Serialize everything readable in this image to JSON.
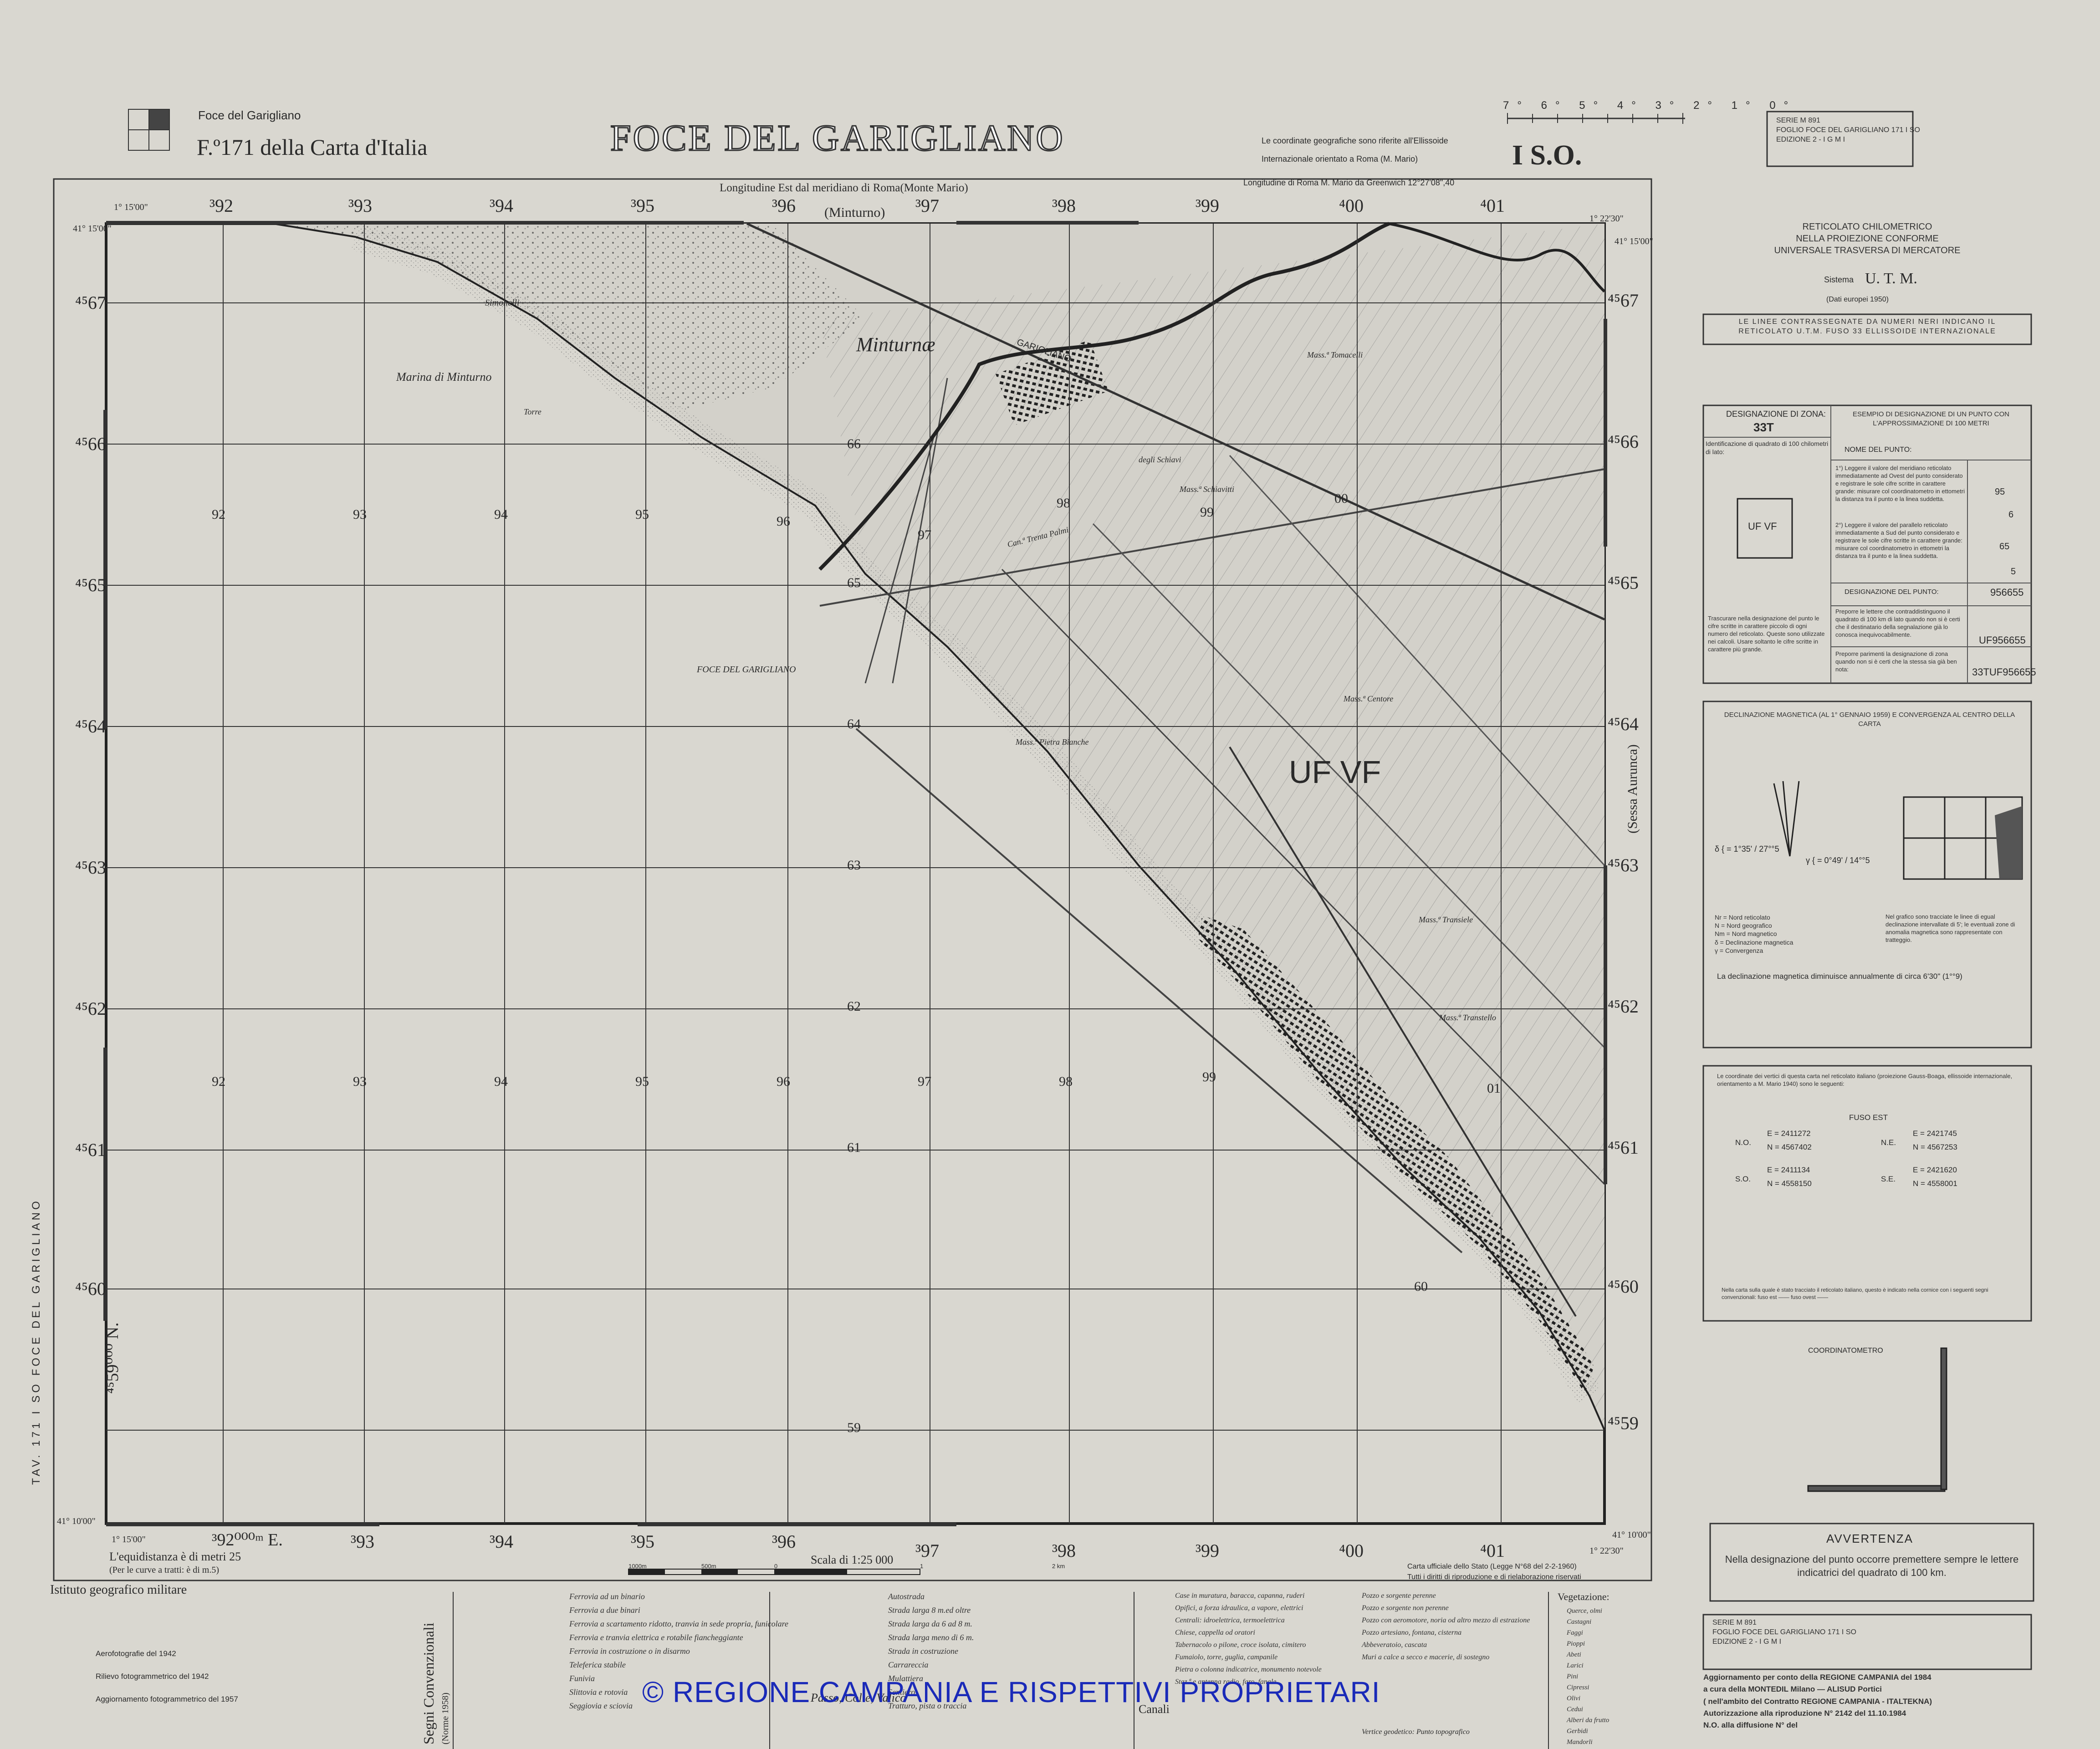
{
  "header": {
    "small_title": "Foce del Garigliano",
    "sheet": "F.º171 della Carta d'Italia",
    "main_title": "FOCE DEL GARIGLIANO",
    "quadrant": "I S.O.",
    "ellipsoid_note_1": "Le coordinate geografiche sono riferite all'Ellissoide",
    "ellipsoid_note_2": "Internazionale orientato a Roma (M. Mario)",
    "longitude_note": "Longitudine Est dal meridiano di Roma(Monte Mario)",
    "greenwich_note": "Longitudine di Roma M. Mario da Greenwich 12°27'08\",40",
    "scale_ticks": "7° 6° 5° 4° 3° 2° 1° 0°"
  },
  "map": {
    "corner_labels": {
      "top_left": "1° 15'00\"",
      "top_right": "1° 22'30\"",
      "bottom_left": "1° 15'00\"",
      "bottom_right": "1° 22'30\"",
      "lat_top_left": "41° 15'00\"",
      "lat_top_right": "41° 15'00\"",
      "lat_bottom_left": "41° 10'00\"",
      "lat_bottom_right": "41° 10'00\""
    },
    "top_eastings": [
      "³92",
      "³93",
      "³94",
      "³95",
      "³96",
      "³97",
      "³98",
      "³99",
      "⁴00",
      "⁴01"
    ],
    "bottom_eastings": [
      "³92⁰⁰⁰ᵐ E.",
      "³93",
      "³94",
      "³95",
      "³96",
      "³97",
      "³98",
      "³99",
      "⁴00",
      "⁴01"
    ],
    "left_northings": [
      "⁴⁵67",
      "⁴⁵66",
      "⁴⁵65",
      "⁴⁵64",
      "⁴⁵63",
      "⁴⁵62",
      "⁴⁵61",
      "⁴⁵60",
      "⁴⁵59⁰⁰⁰ N."
    ],
    "right_northings": [
      "⁴⁵67",
      "⁴⁵66",
      "⁴⁵65",
      "⁴⁵64",
      "⁴⁵63",
      "⁴⁵62",
      "⁴⁵61",
      "⁴⁵60",
      "⁴⁵59"
    ],
    "inner_easting_labels": [
      "92",
      "93",
      "94",
      "95",
      "96",
      "97",
      "98",
      "99"
    ],
    "inner_northing_labels": [
      "66",
      "65",
      "64",
      "63",
      "62",
      "61",
      "60",
      "59"
    ],
    "place_names": [
      "Marina di Minturno",
      "Minturnæ",
      "Simonelli",
      "GARIGLIANO",
      "FOCE DEL GARIGLIANO",
      "UF VF",
      "(Sessa Aurunca)",
      "(Minturno)",
      "Torre",
      "Mass.ª Tomacelli",
      "Mass.ª Centore",
      "Mass.ª Transiele",
      "Mass.ª Transtello",
      "degli Schiavi",
      "Mass.ª Schiavitti",
      "Can.ª Trenta Palmi",
      "Mass.ª Pietra Bianche"
    ],
    "map_ref_marks": [
      "00",
      "01"
    ],
    "zone_label": "UF VF"
  },
  "side_panel": {
    "series_box": {
      "line1": "SERIE  M 891",
      "line2": "FOGLIO  FOCE DEL GARIGLIANO 171 I SO",
      "line3": "EDIZIONE 2  -  I G M I"
    },
    "grid_title": [
      "RETICOLATO  CHILOMETRICO",
      "NELLA  PROIEZIONE  CONFORME",
      "UNIVERSALE  TRASVERSA  DI  MERCATORE"
    ],
    "system_label": "Sistema",
    "system": "U. T. M.",
    "datum": "(Dati europei 1950)",
    "lines_note": "LE LINEE CONTRASSEGNATE DA NUMERI NERI INDICANO IL RETICOLATO U.T.M. FUSO 33 ELLISSOIDE INTERNAZIONALE",
    "zone_designation_label": "DESIGNAZIONE DI ZONA:",
    "zone_value": "33T",
    "square_ident": "Identificazione di quadrato di 100 chilometri di lato:",
    "square_value": "UF VF",
    "point_example_title": "ESEMPIO DI DESIGNAZIONE DI UN PUNTO CON L'APPROSSIMAZIONE DI 100 METRI",
    "point_name_label": "NOME DEL PUNTO:",
    "step1": "1°) Leggere il valore del meridiano reticolato immediatamente ad Ovest del punto considerato e registrare le sole cifre scritte in carattere grande: misurare col coordinatometro in ettometri la distanza tra il punto e la linea suddetta.",
    "step2": "2°) Leggere il valore del parallelo reticolato immediatamente a Sud del punto considerato e registrare le sole cifre scritte in carattere grande: misurare col coordinatometro in ettometri la distanza tra il punto e la linea suddetta.",
    "step_values": [
      "95",
      "6",
      "65",
      "5"
    ],
    "point_designation_label": "DESIGNAZIONE DEL PUNTO:",
    "point_designation_value": "956655",
    "prefix_note": "Preporre le lettere che contraddistinguono il quadrato di 100 km di lato quando non si è certi che il destinatario della segnalazione già lo conosca inequivocabilmente.",
    "prefix_value": "UF956655",
    "zone_prefix_note": "Preporre parimenti la designazione di zona quando non si è certi che la stessa sia già ben nota:",
    "zone_prefix_value": "33TUF956655",
    "neglect_note": "Trascurare nella designazione del punto le cifre scritte in carattere piccolo di ogni numero del reticolato. Queste sono utilizzate nei calcoli. Usare soltanto le cifre scritte in carattere più grande.",
    "decl_title": "DECLINAZIONE MAGNETICA (AL 1° GENNAIO 1959) E CONVERGENZA AL CENTRO DELLA CARTA",
    "decl_values": {
      "delta": "δ { = 1°35' / 27°°5",
      "gamma": "γ { = 0°49' / 14°°5"
    },
    "decl_legend": [
      "Nr  =  Nord reticolato",
      "N   =  Nord geografico",
      "Nm  =  Nord magnetico",
      "δ   =  Declinazione magnetica",
      "γ   =  Convergenza"
    ],
    "decl_note": "Nel grafico sono tracciate le linee di egual declinazione intervallate di 5'; le eventuali zone di anomalia magnetica sono rappresentate con tratteggio.",
    "decl_annual": "La declinazione magnetica diminuisce annualmente di circa 6'30\" (1°°9)",
    "coord_note": "Le coordinate dei vertici di questa carta nel reticolato italiano (proiezione Gauss-Boaga, ellissoide internazionale, orientamento a M. Mario 1940) sono le seguenti:",
    "fuso": "FUSO EST",
    "corners": [
      {
        "label": "N.O.",
        "E": "E = 2411272",
        "N": "N = 4567402"
      },
      {
        "label": "N.E.",
        "E": "E = 2421745",
        "N": "N = 4567253"
      },
      {
        "label": "S.O.",
        "E": "E = 2411134",
        "N": "N = 4558150"
      },
      {
        "label": "S.E.",
        "E": "E = 2421620",
        "N": "N = 4558001"
      }
    ],
    "coord_footer": "Nella carta sulla quale è stato tracciato il reticolato italiano, questo è indicato nella cornice con i seguenti segni convenzionali: fuso est ——  fuso ovest ——",
    "coordinatometro": "COORDINATOMETRO",
    "warning_title": "AVVERTENZA",
    "warning_text": "Nella designazione del punto occorre premettere sempre le lettere indicatrici del quadrato di 100 km.",
    "series_box2": {
      "line1": "SERIE  M 891",
      "line2": "FOGLIO  FOCE DEL GARIGLIANO 171 I SO",
      "line3": "EDIZIONE 2  -  I G M I"
    },
    "update_note": [
      "Aggiornamento per conto della REGIONE CAMPANIA del 1984",
      "a cura della MONTEDIL Milano — ALISUD Portici",
      "( nell'ambito del Contratto REGIONE CAMPANIA - ITALTEKNA)",
      "Autorizzazione alla riproduzione N° 2142   del 11.10.1984",
      "N.O. alla diffusione N°        del"
    ]
  },
  "footer": {
    "contour_note_1": "L'equidistanza è di metri 25",
    "contour_note_2": "(Per le curve a tratti: è di m.5)",
    "institute": "Istituto geografico militare",
    "scale": "Scala di 1:25 000",
    "scale_marks": [
      "1000m",
      "500m",
      "0",
      "1",
      "2 km"
    ],
    "official": "Carta ufficiale dello Stato (Legge N°68 del 2-2-1960)",
    "rights": "Tutti i diritti di riproduzione e di rielaborazione riservati",
    "history": [
      "Aerofotografie del 1942",
      "Rilievo fotogrammetrico del 1942",
      "Aggiornamento fotogrammetrico del 1957"
    ],
    "legend_title": "Segni Convenzionali",
    "legend_subtitle": "(Norme 1958)",
    "legend_col1": [
      "Ferrovia ad un binario",
      "Ferrovia a due binari",
      "Ferrovia a scartamento ridotto, tranvia in sede propria, funicolare",
      "Ferrovia e tranvia elettrica e rotabile fiancheggiante",
      "Ferrovia in costruzione o in disarmo",
      "Teleferica stabile",
      "Funivia",
      "Slittovia e rotovia",
      "Seggiovia e sciovia"
    ],
    "legend_col2": [
      "Autostrada",
      "Strada larga 8 m.ed oltre",
      "Strada larga da 6 ad 8 m.",
      "Strada larga meno di 6 m.",
      "Strada in costruzione",
      "Carrareccia",
      "Mulattiera",
      "Sentiero",
      "Tratturo, pista o traccia"
    ],
    "legend_col3": [
      "Case in muratura, baracca, capanna, ruderi",
      "Opifici, a forza idraulica, a vapore, elettrici",
      "Centrali: idroelettrica, termoelettrica",
      "Chiese, cappella od oratori",
      "Tabernacolo o pilone, croce isolata, cimitero",
      "Fumaiolo, torre, guglia, campanile",
      "Pietra o colonna indicatrice, monumento notevole",
      "Staz.ª e antenna radio, faro, fanale"
    ],
    "legend_col4": [
      "Pozzo e sorgente perenne",
      "Pozzo e sorgente non perenne",
      "Pozzo con aeromotore, noria od altro mezzo di estrazione",
      "Pozzo artesiano, fontana, cisterna",
      "Abbeveratoio, cascata",
      "Muri a calce a secco e macerie, di sostegno"
    ],
    "vegetation_title": "Vegetazione:",
    "vegetation": [
      "Querce, olmi",
      "Castagni",
      "Faggi",
      "Pioppi",
      "Abeti",
      "Larici",
      "Pini",
      "Cipressi",
      "Olivi",
      "Cedui",
      "Alberi da frutto",
      "Gerbidi",
      "Mandorli"
    ],
    "rasso": "Passo, Colle, Valico",
    "canali": "Canali",
    "geodetic": "Vertice geodetico: Punto topografico",
    "tav_vertical": "TAV. 171 I SO FOCE DEL GARIGLIANO",
    "watermark": "© REGIONE CAMPANIA E RISPETTIVI PROPRIETARI"
  }
}
